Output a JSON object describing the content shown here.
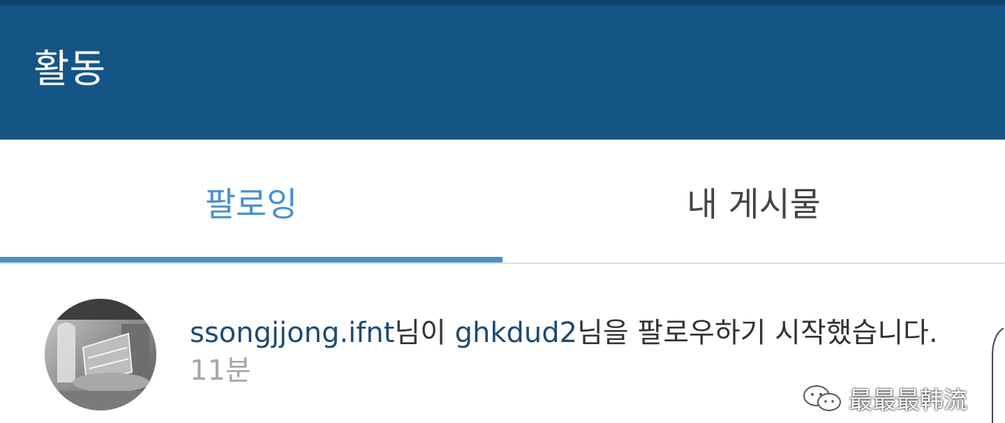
{
  "header": {
    "title": "활동"
  },
  "tabs": [
    {
      "label": "팔로잉",
      "active": true
    },
    {
      "label": "내 게시물",
      "active": false
    }
  ],
  "activity": {
    "user1": "ssongjjong.ifnt",
    "text1": "님이 ",
    "user2": "ghkdud2",
    "text2": "님을 팔로우하기 시작했습니다.",
    "time": "11분"
  },
  "watermark": {
    "text": "最最最韩流",
    "icon": "wechat-icon"
  },
  "colors": {
    "header_bg": "#155586",
    "accent": "#4a90d0",
    "username": "#1d4a72",
    "time": "#a5a5a5"
  }
}
